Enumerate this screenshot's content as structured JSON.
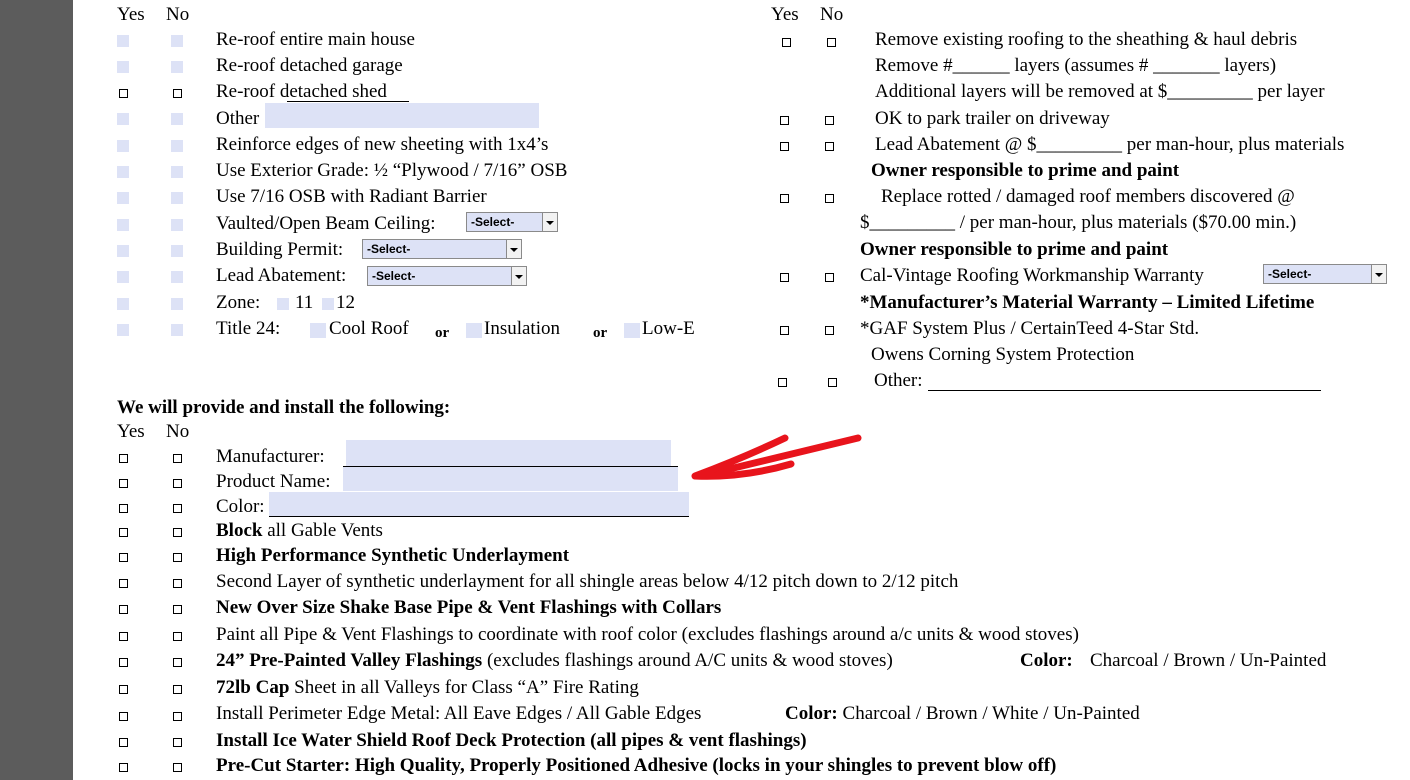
{
  "left_header": {
    "yes": "Yes",
    "no": "No"
  },
  "right_header": {
    "yes": "Yes",
    "no": "No"
  },
  "left_items": [
    "Re-roof entire main house",
    "Re-roof detached garage",
    "Re-roof detached shed",
    "Other",
    "Reinforce edges of new sheeting with 1x4’s",
    "Use Exterior Grade:  ½ “Plywood  /  7/16” OSB",
    "Use 7/16 OSB with Radiant Barrier",
    "Vaulted/Open Beam Ceiling:",
    "Building Permit:",
    "Lead Abatement:",
    "Zone: ",
    "Title 24:"
  ],
  "zone_options": [
    "11",
    "12"
  ],
  "title24": {
    "cool_roof": "Cool Roof",
    "or1": "or",
    "insulation": "Insulation",
    "or2": "or",
    "low_e": "Low-E"
  },
  "select_default": "-Select-",
  "right_items": {
    "remove_existing": "Remove existing roofing to the sheathing & haul debris",
    "remove_layers": "Remove #______ layers    (assumes # _______ layers)",
    "additional_layers": "Additional layers will be removed at $_________  per layer",
    "park_trailer": "OK to park trailer on driveway",
    "lead_abatement": "Lead Abatement @ $_________   per man-hour, plus materials",
    "owner_responsible_1": "Owner responsible to prime and paint",
    "replace_rotted": "Replace rotted / damaged roof members discovered @",
    "replace_rate": "$_________ / per man-hour, plus materials ($70.00 min.)",
    "owner_responsible_2": "Owner responsible to prime and paint",
    "workmanship_warranty": "Cal-Vintage Roofing Workmanship Warranty",
    "manufacturer_warranty": "*Manufacturer’s Material Warranty – Limited Lifetime",
    "gaf_system": "*GAF System Plus / CertainTeed 4-Star Std.",
    "owens_corning": "Owens Corning System Protection",
    "other": "Other:"
  },
  "provide_section": {
    "heading": "We will provide and install the following:",
    "yes": "Yes",
    "no": "No",
    "manufacturer": "Manufacturer:",
    "product_name": "Product Name:",
    "color": "Color:",
    "block_bold": "Block",
    "block_rest": " all Gable Vents",
    "underlayment": "High Performance Synthetic Underlayment",
    "second_layer": "Second Layer of synthetic underlayment for all shingle areas below 4/12 pitch down to 2/12 pitch",
    "pipe_flashings": "New Over Size Shake Base Pipe & Vent Flashings with Collars",
    "paint_flashings": "Paint all Pipe & Vent Flashings to coordinate with roof color (excludes flashings around a/c units & wood stoves)",
    "valley_bold": "24” Pre-Painted Valley Flashings",
    "valley_rest": " (excludes flashings around A/C units & wood stoves)",
    "valley_color_label": "Color:",
    "valley_colors": "Charcoal  /  Brown  /  Un-Painted",
    "cap_bold": "72lb Cap",
    "cap_rest": " Sheet in all Valleys for Class “A” Fire Rating",
    "edge_metal": "Install Perimeter Edge Metal: All Eave Edges / All Gable Edges",
    "edge_color_label": "Color:",
    "edge_colors": " Charcoal  /  Brown  /  White  /  Un-Painted",
    "ice_water": "Install Ice Water Shield Roof Deck Protection (all pipes & vent flashings)",
    "starter": "Pre-Cut Starter: High Quality, Properly Positioned Adhesive (locks in your shingles to prevent blow off)"
  },
  "colors": {
    "field_fill": "#dde2f6",
    "arrow": "#e8141c",
    "side_gutter": "#5c5c5c"
  }
}
